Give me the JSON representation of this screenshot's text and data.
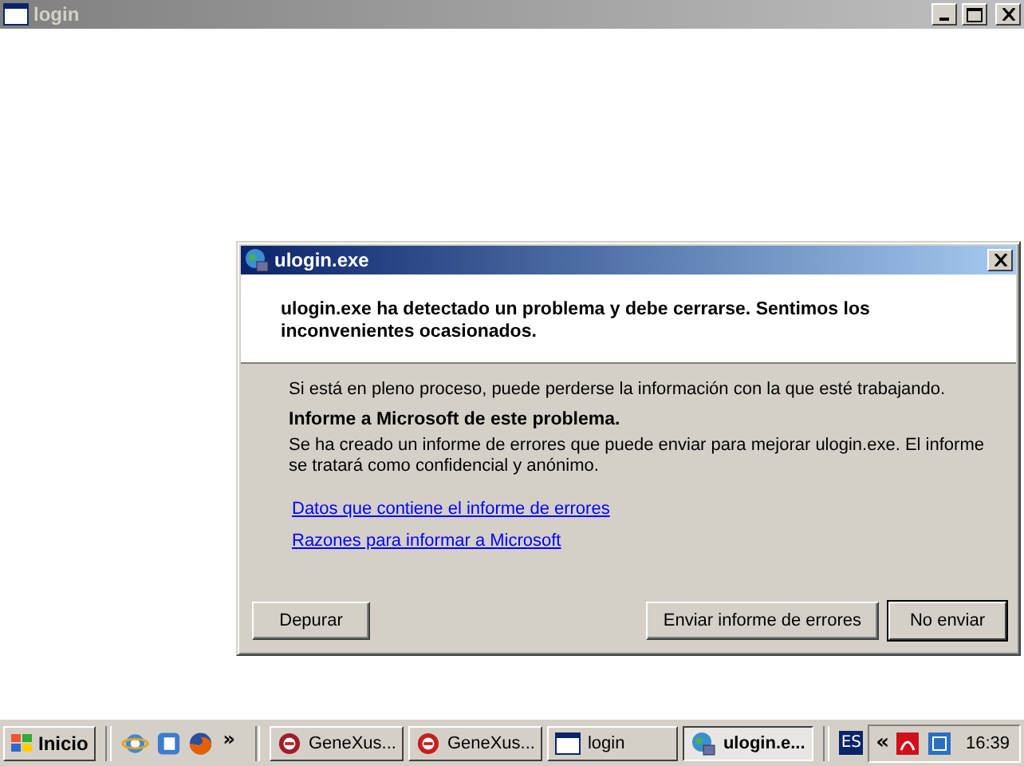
{
  "window": {
    "title": "login"
  },
  "dialog": {
    "title": "ulogin.exe",
    "headline": "ulogin.exe ha detectado un problema y debe cerrarse. Sentimos los inconvenientes ocasionados.",
    "notice": "Si está en pleno proceso, puede perderse la información con la que esté trabajando.",
    "section_title": "Informe a Microsoft de este problema.",
    "section_text": "Se ha creado un informe de errores que puede enviar para mejorar ulogin.exe. El informe se tratará como confidencial y anónimo.",
    "links": [
      "Datos que contiene el informe de errores",
      "Razones para informar a Microsoft"
    ],
    "buttons": [
      {
        "label": "Depurar",
        "default": false
      },
      {
        "label": "Enviar informe de errores",
        "default": false
      },
      {
        "label": "No enviar",
        "default": true
      }
    ]
  },
  "taskbar": {
    "start": "Inicio",
    "more": "»",
    "tasks": [
      {
        "label": "GeneXus...",
        "kind": "genexus",
        "selected": false
      },
      {
        "label": "GeneXus...",
        "kind": "genexus2",
        "selected": false
      },
      {
        "label": "login",
        "kind": "window",
        "selected": false
      },
      {
        "label": "ulogin.e...",
        "kind": "globe",
        "selected": true
      }
    ],
    "language": "ES",
    "tray_expand": "«",
    "clock": "16:39"
  }
}
